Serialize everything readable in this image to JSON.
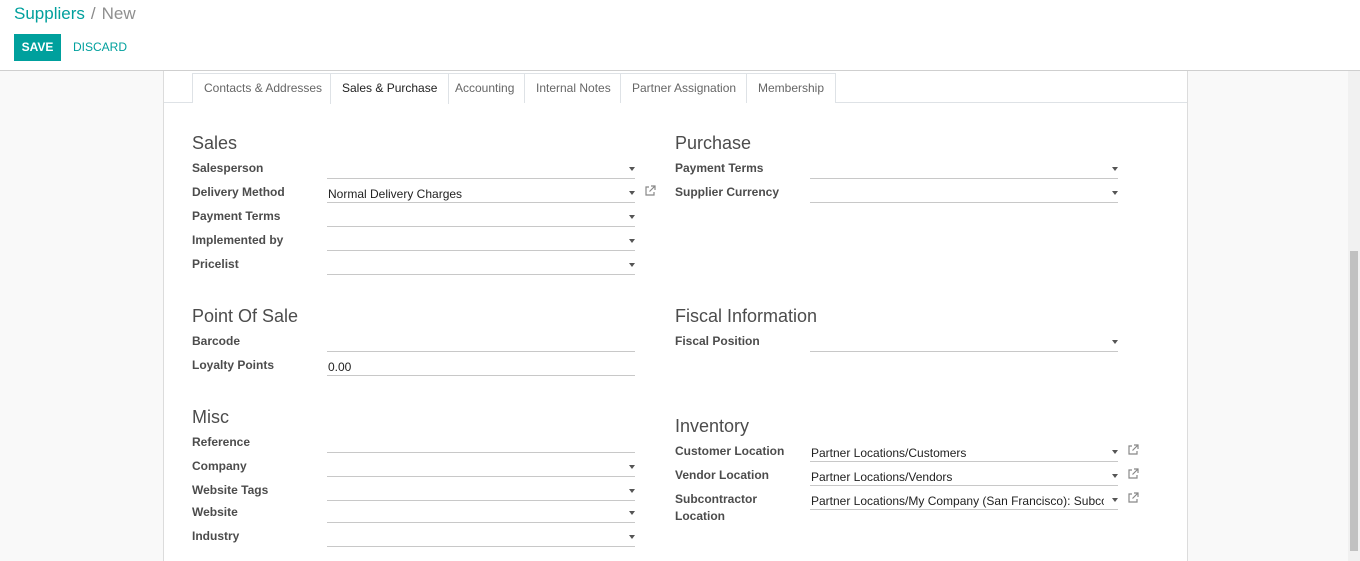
{
  "breadcrumb": {
    "parent": "Suppliers",
    "separator": "/",
    "current": "New"
  },
  "buttons": {
    "save": "SAVE",
    "discard": "DISCARD"
  },
  "tabs": [
    "Contacts & Addresses",
    "Sales & Purchase",
    "Accounting",
    "Internal Notes",
    "Partner Assignation",
    "Membership"
  ],
  "active_tab": "Sales & Purchase",
  "sales": {
    "title": "Sales",
    "salesperson": {
      "label": "Salesperson",
      "value": ""
    },
    "delivery_method": {
      "label": "Delivery Method",
      "value": "Normal Delivery Charges"
    },
    "payment_terms": {
      "label": "Payment Terms",
      "value": ""
    },
    "implemented_by": {
      "label": "Implemented by",
      "value": ""
    },
    "pricelist": {
      "label": "Pricelist",
      "value": ""
    }
  },
  "purchase": {
    "title": "Purchase",
    "payment_terms": {
      "label": "Payment Terms",
      "value": ""
    },
    "supplier_currency": {
      "label": "Supplier Currency",
      "value": ""
    }
  },
  "pos": {
    "title": "Point Of Sale",
    "barcode": {
      "label": "Barcode",
      "value": ""
    },
    "loyalty_points": {
      "label": "Loyalty Points",
      "value": "0.00"
    }
  },
  "fiscal": {
    "title": "Fiscal Information",
    "fiscal_position": {
      "label": "Fiscal Position",
      "value": ""
    }
  },
  "misc": {
    "title": "Misc",
    "reference": {
      "label": "Reference",
      "value": ""
    },
    "company": {
      "label": "Company",
      "value": ""
    },
    "website_tags": {
      "label": "Website Tags",
      "value": ""
    },
    "website": {
      "label": "Website",
      "value": ""
    },
    "industry": {
      "label": "Industry",
      "value": ""
    }
  },
  "inventory": {
    "title": "Inventory",
    "customer_location": {
      "label": "Customer Location",
      "value": "Partner Locations/Customers"
    },
    "vendor_location": {
      "label": "Vendor Location",
      "value": "Partner Locations/Vendors"
    },
    "subcontractor_location": {
      "label_line1": "Subcontractor",
      "label_line2": "Location",
      "value": "Partner Locations/My Company (San Francisco): Subcontracting Location"
    }
  },
  "colors": {
    "primary": "#00a09d"
  },
  "icons": {
    "external_link": "external-link-icon",
    "dropdown": "caret-down-icon"
  }
}
